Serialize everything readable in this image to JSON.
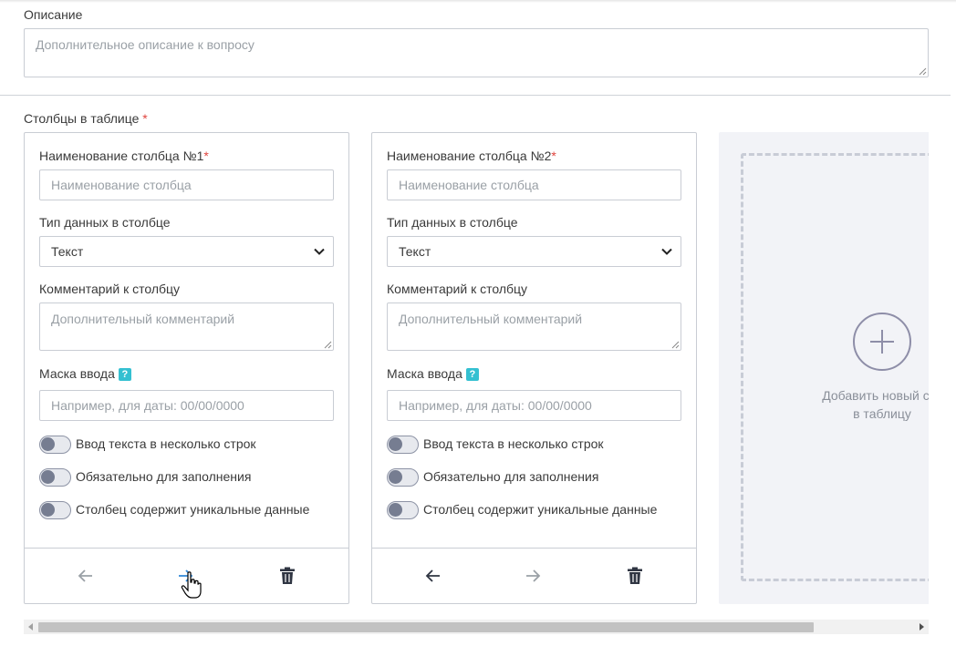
{
  "description_section": {
    "label": "Описание",
    "textarea_placeholder": "Дополнительное описание к вопросу"
  },
  "columns_section": {
    "label": "Столбцы в таблице",
    "required_mark": "*"
  },
  "columns": [
    {
      "name_label": "Наименование столбца №1",
      "required_mark": "*",
      "name_placeholder": "Наименование столбца",
      "type_label": "Тип данных в столбце",
      "type_value": "Текст",
      "comment_label": "Комментарий к столбцу",
      "comment_placeholder": "Дополнительный комментарий",
      "mask_label": "Маска ввода",
      "mask_help_icon": "?",
      "mask_placeholder": "Например, для даты: 00/00/0000",
      "toggles": [
        {
          "label": "Ввод текста в несколько строк",
          "checked": false
        },
        {
          "label": "Обязательно для заполнения",
          "checked": false
        },
        {
          "label": "Столбец содержит уникальные данные",
          "checked": false
        }
      ],
      "nav": {
        "prev_icon": "arrow-left-icon",
        "next_icon": "arrow-right-icon",
        "delete_icon": "trash-icon"
      }
    },
    {
      "name_label": "Наименование столбца №2",
      "required_mark": "*",
      "name_placeholder": "Наименование столбца",
      "type_label": "Тип данных в столбце",
      "type_value": "Текст",
      "comment_label": "Комментарий к столбцу",
      "comment_placeholder": "Дополнительный комментарий",
      "mask_label": "Маска ввода",
      "mask_help_icon": "?",
      "mask_placeholder": "Например, для даты: 00/00/0000",
      "toggles": [
        {
          "label": "Ввод текста в несколько строк",
          "checked": false
        },
        {
          "label": "Обязательно для заполнения",
          "checked": false
        },
        {
          "label": "Столбец содержит уникальные данные",
          "checked": false
        }
      ],
      "nav": {
        "prev_icon": "arrow-left-icon",
        "next_icon": "arrow-right-icon",
        "delete_icon": "trash-icon"
      }
    }
  ],
  "add_column": {
    "icon": "plus-icon",
    "label_line1": "Добавить новый сто",
    "label_line2": "в таблицу"
  },
  "colors": {
    "required": "#e0443e",
    "help_icon": "#34c0d1",
    "nav_active": "#2f86d6",
    "nav_enabled": "#2f3542",
    "nav_disabled": "#9aa0a6"
  }
}
